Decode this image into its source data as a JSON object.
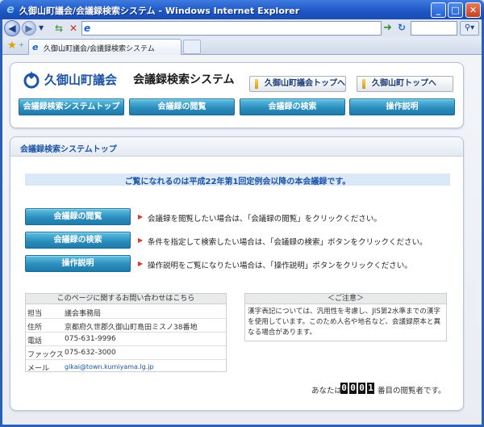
{
  "window": {
    "title": "久御山町議会/会議録検索システム - Windows Internet Explorer",
    "min_glyph": "_",
    "max_glyph": "□",
    "close_glyph": "✕"
  },
  "browser": {
    "url": "",
    "search_text": "",
    "tab_label": "久御山町議会/会議録検索システム"
  },
  "header": {
    "town_name": "久御山町議会",
    "system_name": "会議録検索システム",
    "council_top_label": "久御山町議会トップへ",
    "town_top_label": "久御山町トップへ",
    "nav": [
      {
        "label": "会議録検索システムトップ"
      },
      {
        "label": "会議録の閲覧"
      },
      {
        "label": "会議録の検索"
      },
      {
        "label": "操作説明"
      }
    ]
  },
  "main": {
    "heading": "会議録検索システムトップ",
    "notice": "ご覧になれるのは平成22年第1回定例会以降の本会議録です。",
    "actions": [
      {
        "label": "会議録の閲覧",
        "desc": "会議録を閲覧したい場合は、「会議録の閲覧」をクリックください。"
      },
      {
        "label": "会議録の検索",
        "desc": "条件を指定して検索したい場合は、「会議録の検索」ボタンをクリックください。"
      },
      {
        "label": "操作説明",
        "desc": "操作説明をご覧になりたい場合は、「操作説明」ボタンをクリックください。"
      }
    ]
  },
  "contact": {
    "heading": "このページに関するお問い合わせはこちら",
    "rows": [
      {
        "key": "担当",
        "value": "議会事務局"
      },
      {
        "key": "住所",
        "value": "京都府久世郡久御山町島田ミスノ38番地"
      },
      {
        "key": "電話",
        "value": "075-631-9996"
      },
      {
        "key": "ファックス",
        "value": "075-632-3000"
      },
      {
        "key": "メール",
        "value": "gikai@town.kumiyama.lg.jp"
      }
    ]
  },
  "caution": {
    "heading": "＜ご注意＞",
    "body": "漢字表記については、汎用性を考慮し、JIS第2水準までの漢字を使用しています。このため人名や地名など、会議録原本と異なる場合があります。"
  },
  "counter": {
    "prefix": "あなたは",
    "digits": [
      "0",
      "0",
      "0",
      "1"
    ],
    "suffix": "番目の閲覧者です。"
  },
  "colors": {
    "accent": "#1d54a8",
    "button": "#2c8fbf",
    "notice_bg": "#dbe8f7"
  }
}
